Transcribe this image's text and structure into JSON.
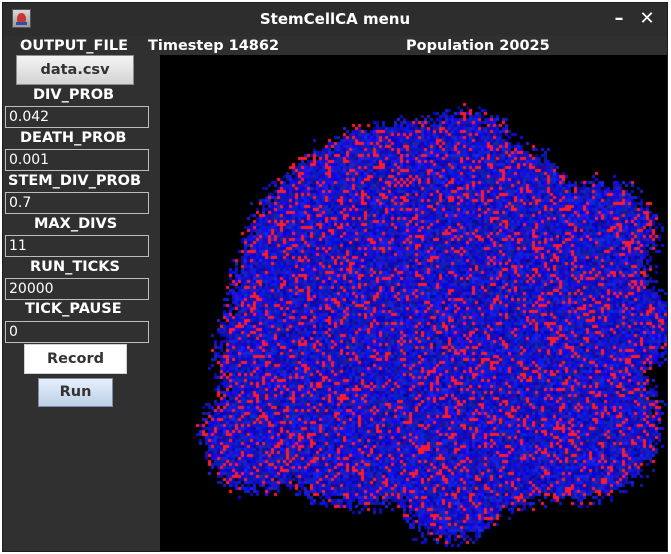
{
  "window": {
    "title": "StemCellCA menu",
    "minimize_label": "–",
    "close_label": "✕"
  },
  "header": {
    "output_file_label": "OUTPUT_FILE",
    "timestep": "Timestep 14862",
    "population": "Population 20025"
  },
  "output_file_button": "data.csv",
  "params": [
    {
      "label": "DIV_PROB",
      "value": "0.042"
    },
    {
      "label": "DEATH_PROB",
      "value": "0.001"
    },
    {
      "label": "STEM_DIV_PROB",
      "value": "0.7"
    },
    {
      "label": "MAX_DIVS",
      "value": "11"
    },
    {
      "label": "RUN_TICKS",
      "value": "20000"
    },
    {
      "label": "TICK_PAUSE",
      "value": "0"
    }
  ],
  "buttons": {
    "record": "Record",
    "run": "Run"
  },
  "colors": {
    "background_cell": "#1f2fd0",
    "dividing_cell": "#ff1a2e",
    "canvas_bg": "#000000"
  }
}
